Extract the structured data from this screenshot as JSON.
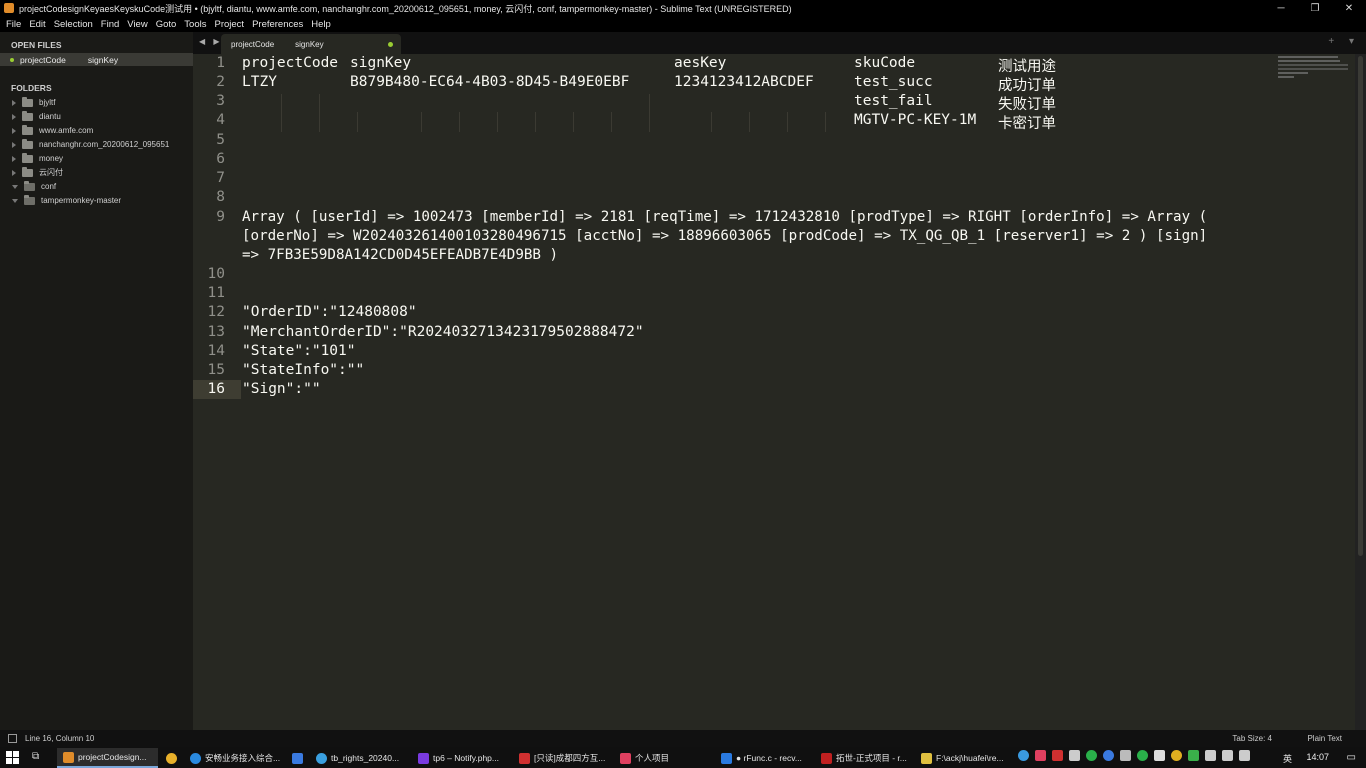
{
  "window": {
    "title": "projectCodesignKeyaesKeyskuCode测试用 • (bjyltf, diantu, www.amfe.com, nanchanghr.com_20200612_095651, money, 云闪付, conf, tampermonkey-master) - Sublime Text (UNREGISTERED)",
    "minimize": "─",
    "maximize": "❐",
    "close": "✕"
  },
  "menu": [
    "File",
    "Edit",
    "Selection",
    "Find",
    "View",
    "Goto",
    "Tools",
    "Project",
    "Preferences",
    "Help"
  ],
  "sidebar": {
    "open_files_heading": "OPEN FILES",
    "open_file": {
      "name": "projectCode",
      "name2": "signKey"
    },
    "folders_heading": "FOLDERS",
    "folders": [
      {
        "name": "bjyltf",
        "open": false
      },
      {
        "name": "diantu",
        "open": false
      },
      {
        "name": "www.amfe.com",
        "open": false
      },
      {
        "name": "nanchanghr.com_20200612_095651",
        "open": false
      },
      {
        "name": "money",
        "open": false
      },
      {
        "name": "云闪付",
        "open": false
      },
      {
        "name": "conf",
        "open": true
      },
      {
        "name": "tampermonkey-master",
        "open": true
      }
    ]
  },
  "tab": {
    "nav": "◀ ▶",
    "label1": "projectCode",
    "label2": "signKey",
    "right_controls": "+ ▾"
  },
  "editor": {
    "current_line": 16,
    "line_numbers": [
      "1",
      "2",
      "3",
      "4",
      "5",
      "6",
      "7",
      "8",
      "9",
      "10",
      "11",
      "12",
      "13",
      "14",
      "15",
      "16"
    ],
    "table": {
      "header": [
        "projectCode",
        "signKey",
        "aesKey",
        "skuCode",
        "测试用途"
      ],
      "row2": [
        "LTZY",
        "B879B480-EC64-4B03-8D45-B49E0EBF",
        "1234123412ABCDEF",
        "test_succ",
        "成功订单"
      ],
      "row3": [
        "test_fail",
        "失败订单"
      ],
      "row4": [
        "MGTV-PC-KEY-1M",
        "卡密订单"
      ]
    },
    "array_lines": [
      "Array ( [userId] => 1002473 [memberId] => 2181 [reqTime] => 1712432810 [prodType] => RIGHT [orderInfo] => Array (",
      "[orderNo] => W20240326140010328049671​5 [acctNo] => 18896603065 [prodCode] => TX_QG_QB_1 [reserver1] => 2 ) [sign]",
      "=> 7FB3E59D8A142CD0D45EFEADB7E4D9BB )"
    ],
    "json_lines": [
      "\"OrderID\":\"12480808\"",
      "\"MerchantOrderID\":\"R202403271342317950288847​2\"",
      "\"State\":\"101\"",
      "\"StateInfo\":\"\"",
      "\"Sign\":\"\""
    ]
  },
  "status": {
    "position": "Line 16, Column 10",
    "tab_size": "Tab Size: 4",
    "syntax": "Plain Text"
  },
  "taskbar": {
    "items": [
      {
        "label": "projectCodesign...",
        "color": "#e08c2a",
        "active": true
      },
      {
        "label": "",
        "color": "#e8b02a",
        "active": false
      },
      {
        "label": "安畅业务接入综合...",
        "color": "#2a8ae0",
        "active": false
      },
      {
        "label": "",
        "color": "#3a7ae0",
        "active": false
      },
      {
        "label": "tb_rights_20240...",
        "color": "#3aa0e0",
        "active": false
      },
      {
        "label": "tp6 – Notify.php...",
        "color": "#7a3ae0",
        "active": false
      },
      {
        "label": "[只读]成都四方互...",
        "color": "#d03030",
        "active": false
      },
      {
        "label": "个人项目",
        "color": "#e04060",
        "active": false
      },
      {
        "label": "● rFunc.c - recv...",
        "color": "#2a7ae0",
        "active": false
      },
      {
        "label": "拓世-正式项目 - r...",
        "color": "#c02020",
        "active": false
      },
      {
        "label": "F:\\ackj\\huafei\\re...",
        "color": "#e0c040",
        "active": false
      }
    ],
    "ime": "英",
    "clock": "14:07"
  }
}
